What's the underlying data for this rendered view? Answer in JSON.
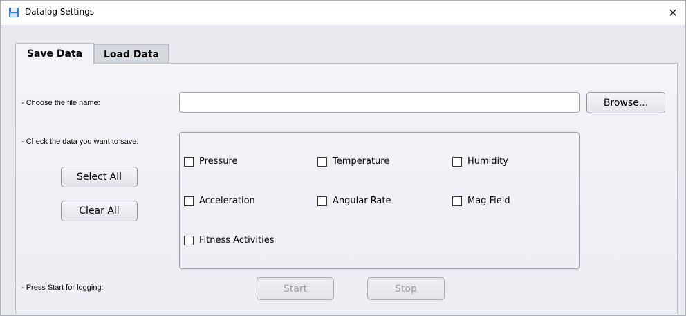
{
  "window": {
    "title": "Datalog Settings",
    "close_glyph": "✕",
    "icon": "floppy-disk-icon"
  },
  "tabs": [
    {
      "label": "Save Data",
      "active": true
    },
    {
      "label": "Load Data",
      "active": false
    }
  ],
  "save_panel": {
    "file_label": "- Choose the file name:",
    "file_value": "",
    "browse_label": "Browse...",
    "check_label": "- Check the data you want to save:",
    "select_all_label": "Select All",
    "clear_all_label": "Clear All",
    "checkboxes": [
      {
        "label": "Pressure",
        "checked": false
      },
      {
        "label": "Temperature",
        "checked": false
      },
      {
        "label": "Humidity",
        "checked": false
      },
      {
        "label": "Acceleration",
        "checked": false
      },
      {
        "label": "Angular Rate",
        "checked": false
      },
      {
        "label": "Mag Field",
        "checked": false
      },
      {
        "label": "Fitness Activities",
        "checked": false
      }
    ],
    "logging_label": "- Press Start for logging:",
    "start_label": "Start",
    "stop_label": "Stop"
  },
  "colors": {
    "panel_bg": "#eceef4",
    "tab_inactive": "#d6d8e0",
    "disabled_text": "#9a9ca4"
  }
}
